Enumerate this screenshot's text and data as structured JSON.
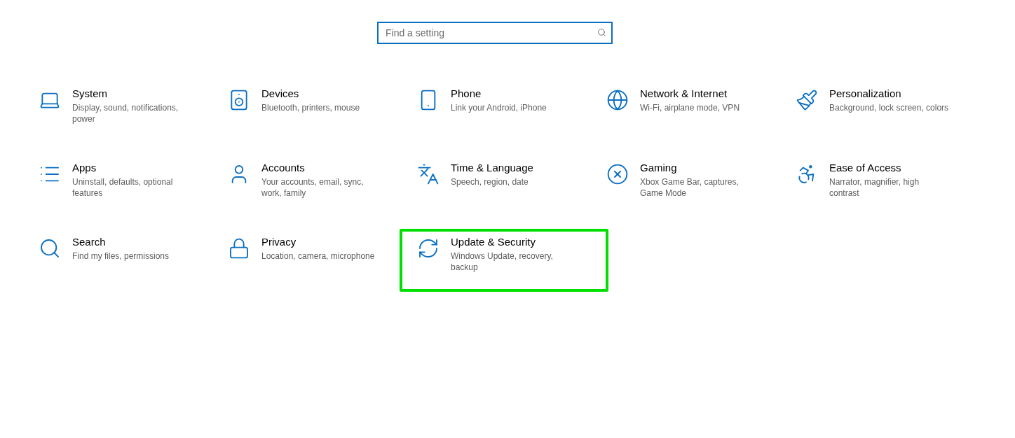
{
  "search": {
    "placeholder": "Find a setting"
  },
  "categories": [
    {
      "title": "System",
      "description": "Display, sound, notifications, power",
      "highlighted": false
    },
    {
      "title": "Devices",
      "description": "Bluetooth, printers, mouse",
      "highlighted": false
    },
    {
      "title": "Phone",
      "description": "Link your Android, iPhone",
      "highlighted": false
    },
    {
      "title": "Network & Internet",
      "description": "Wi-Fi, airplane mode, VPN",
      "highlighted": false
    },
    {
      "title": "Personalization",
      "description": "Background, lock screen, colors",
      "highlighted": false
    },
    {
      "title": "Apps",
      "description": "Uninstall, defaults, optional features",
      "highlighted": false
    },
    {
      "title": "Accounts",
      "description": "Your accounts, email, sync, work, family",
      "highlighted": false
    },
    {
      "title": "Time & Language",
      "description": "Speech, region, date",
      "highlighted": false
    },
    {
      "title": "Gaming",
      "description": "Xbox Game Bar, captures, Game Mode",
      "highlighted": false
    },
    {
      "title": "Ease of Access",
      "description": "Narrator, magnifier, high contrast",
      "highlighted": false
    },
    {
      "title": "Search",
      "description": "Find my files, permissions",
      "highlighted": false
    },
    {
      "title": "Privacy",
      "description": "Location, camera, microphone",
      "highlighted": false
    },
    {
      "title": "Update & Security",
      "description": "Windows Update, recovery, backup",
      "highlighted": true
    }
  ]
}
